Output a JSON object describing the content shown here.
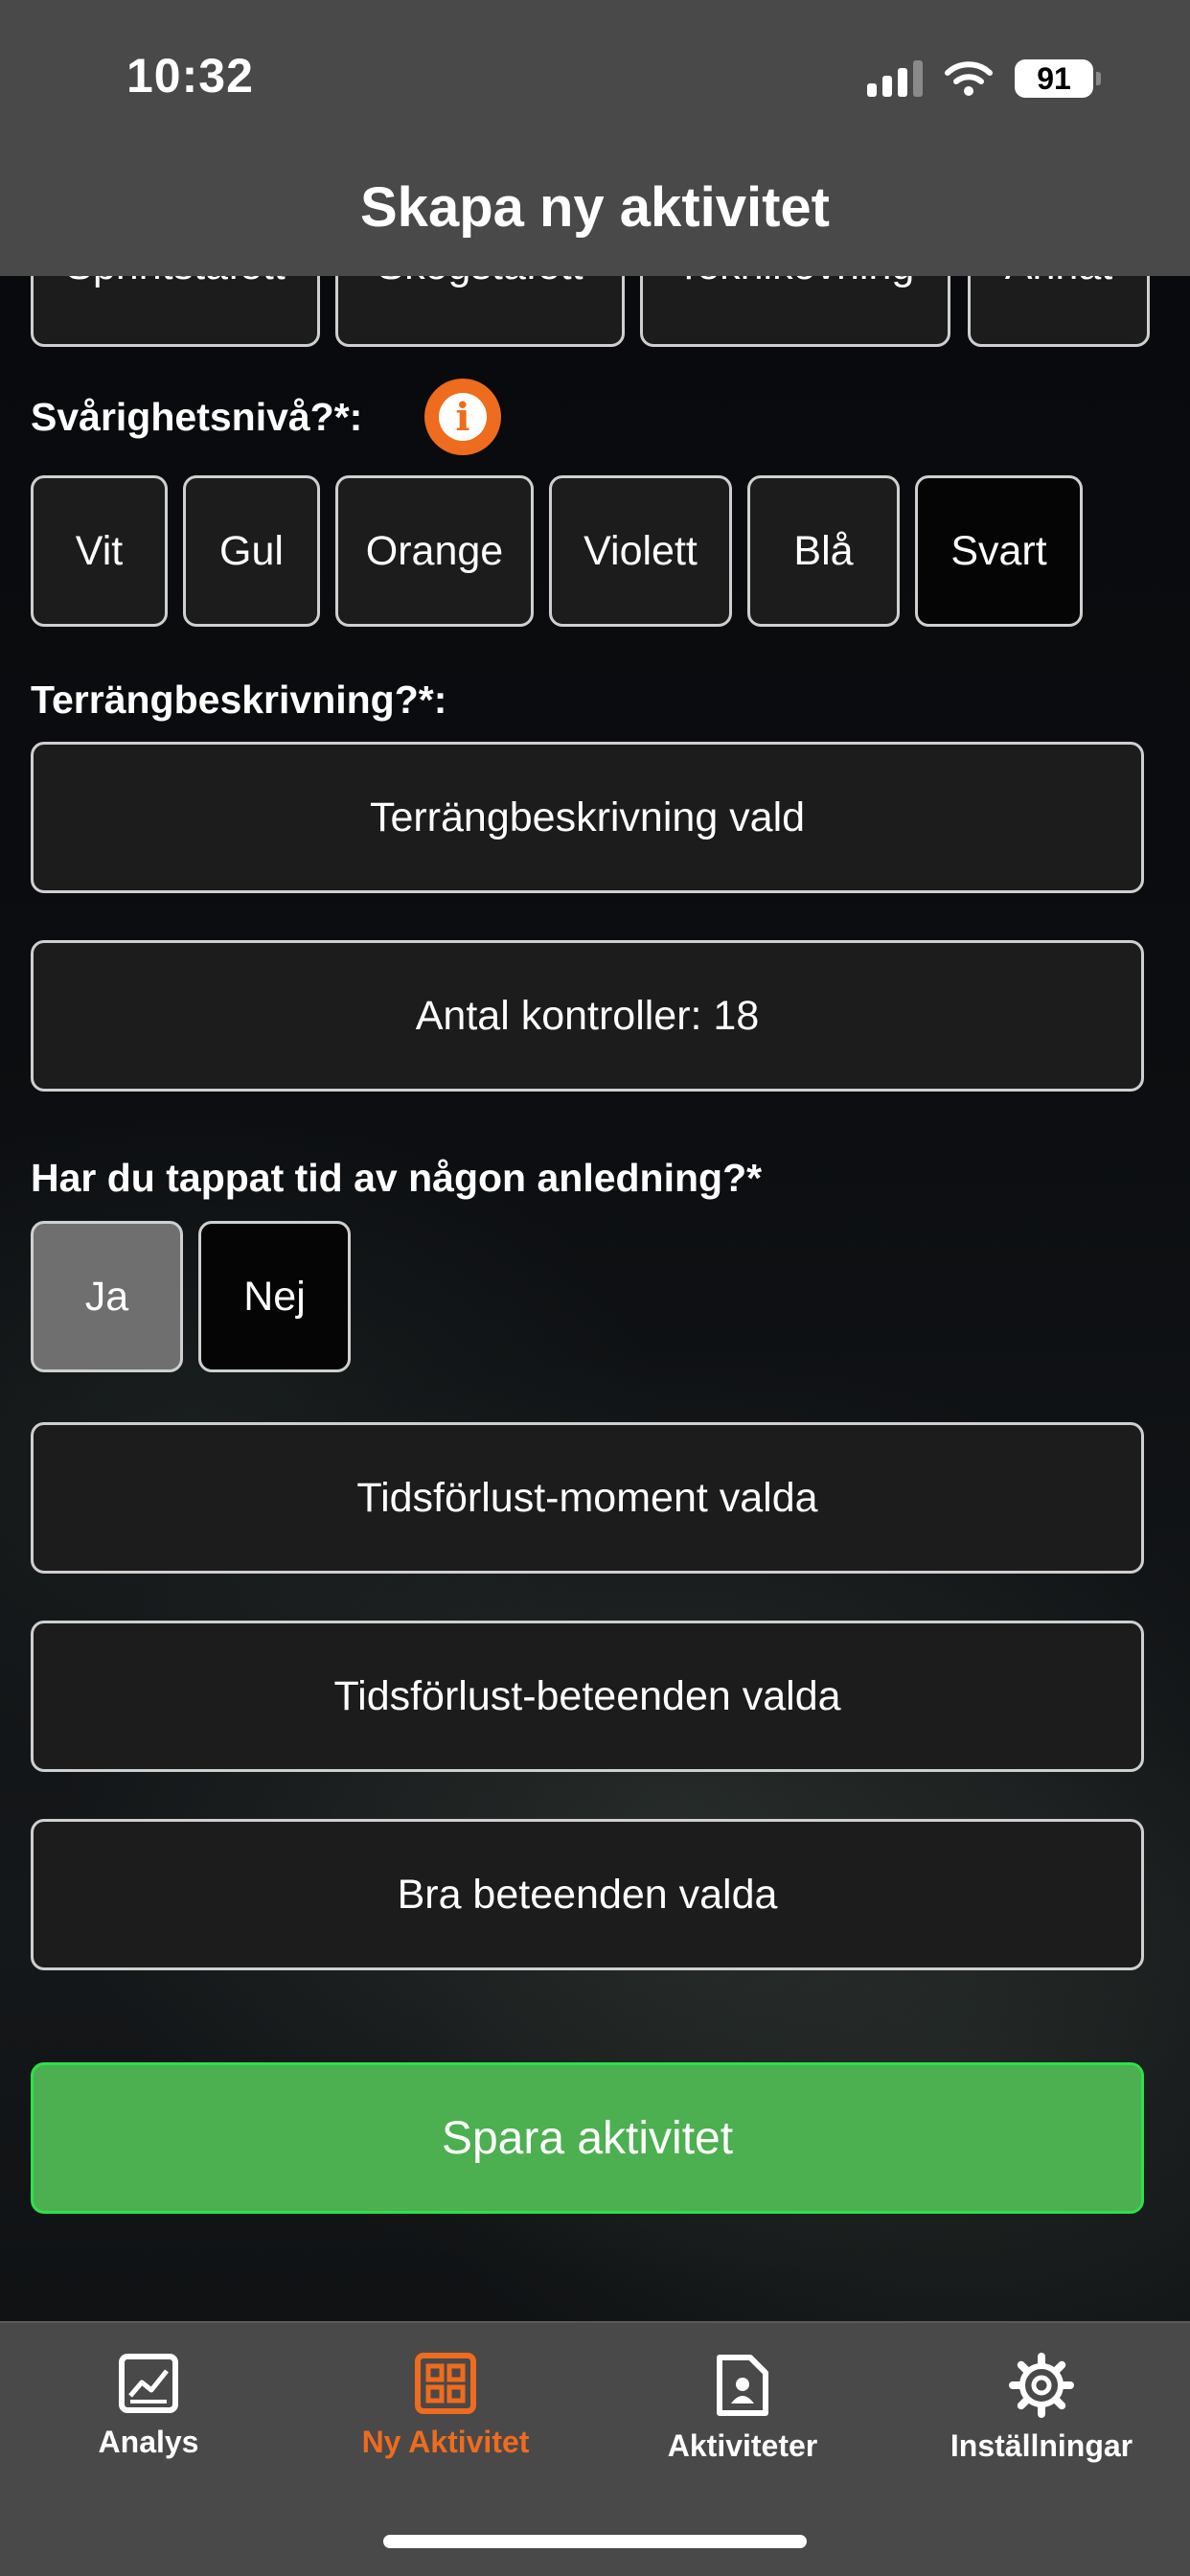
{
  "status_bar": {
    "time": "10:32",
    "battery": "91"
  },
  "header": {
    "title": "Skapa ny aktivitet"
  },
  "activity_types": [
    "Sprintstafett",
    "Skogstafett",
    "Teknikövning",
    "Annat"
  ],
  "difficulty": {
    "label": "Svårighetsnivå?*:",
    "options": [
      "Vit",
      "Gul",
      "Orange",
      "Violett",
      "Blå",
      "Svart"
    ],
    "selected": "Svart"
  },
  "terrain": {
    "label": "Terrängbeskrivning?*:",
    "button": "Terrängbeskrivning vald",
    "controls": "Antal kontroller: 18"
  },
  "time_loss": {
    "label": "Har du tappat tid av någon anledning?*",
    "options": [
      "Ja",
      "Nej"
    ],
    "selected": "Ja",
    "moments_button": "Tidsförlust-moment valda",
    "behaviours_button": "Tidsförlust-beteenden valda",
    "good_button": "Bra beteenden valda"
  },
  "save_button": "Spara aktivitet",
  "colors": {
    "accent": "#ef6b1d",
    "save": "#4caf50",
    "bar": "#494949"
  },
  "tabs": [
    {
      "label": "Analys",
      "icon": "chart-icon"
    },
    {
      "label": "Ny Aktivitet",
      "icon": "grid-icon",
      "active": true
    },
    {
      "label": "Aktiviteter",
      "icon": "document-user-icon"
    },
    {
      "label": "Inställningar",
      "icon": "gear-icon"
    }
  ]
}
